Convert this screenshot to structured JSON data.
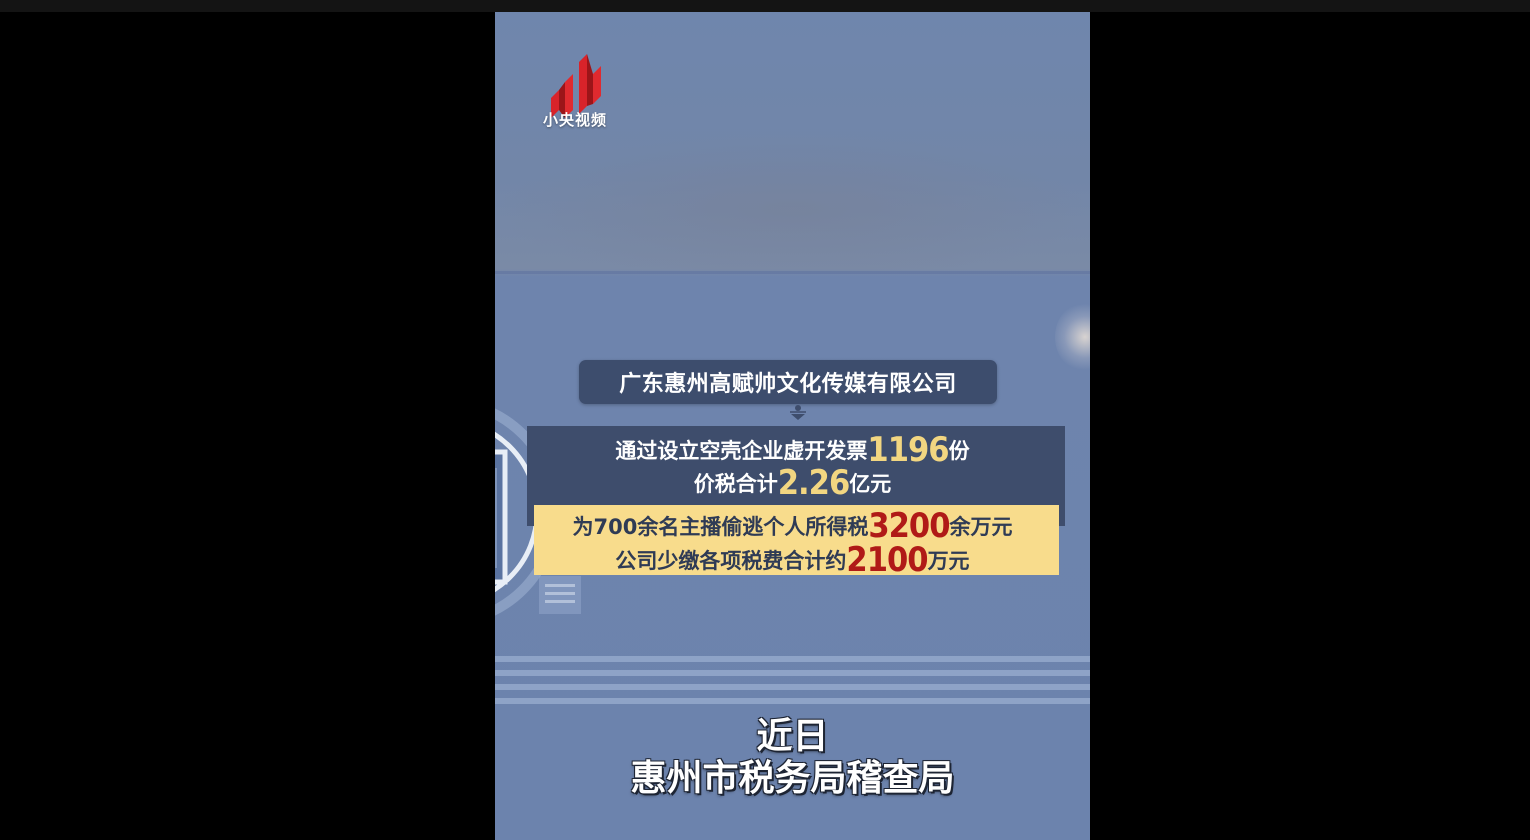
{
  "logo": {
    "text": "小央视频",
    "color": "#d8232a"
  },
  "card": {
    "company": "广东惠州高赋帅文化传媒有限公司",
    "line1": {
      "prefix": "通过设立空壳企业虚开发票",
      "number": "1196",
      "suffix": "份"
    },
    "line2": {
      "prefix": "价税合计",
      "number": "2.26",
      "suffix": "亿元"
    },
    "line3": {
      "prefix": "为700余名主播偷逃个人所得税",
      "number": "3200",
      "suffix": "余万元"
    },
    "line4": {
      "prefix": "公司少缴各项税费合计约",
      "number": "2100",
      "suffix": "万元"
    }
  },
  "subtitle": {
    "line1": "近日",
    "line2": "惠州市税务局稽查局"
  },
  "colors": {
    "highlight_gold": "#f2d681",
    "highlight_red": "#b01a17",
    "panel_dark": "#3e4d6c",
    "panel_yellow": "#f8dc8c"
  }
}
